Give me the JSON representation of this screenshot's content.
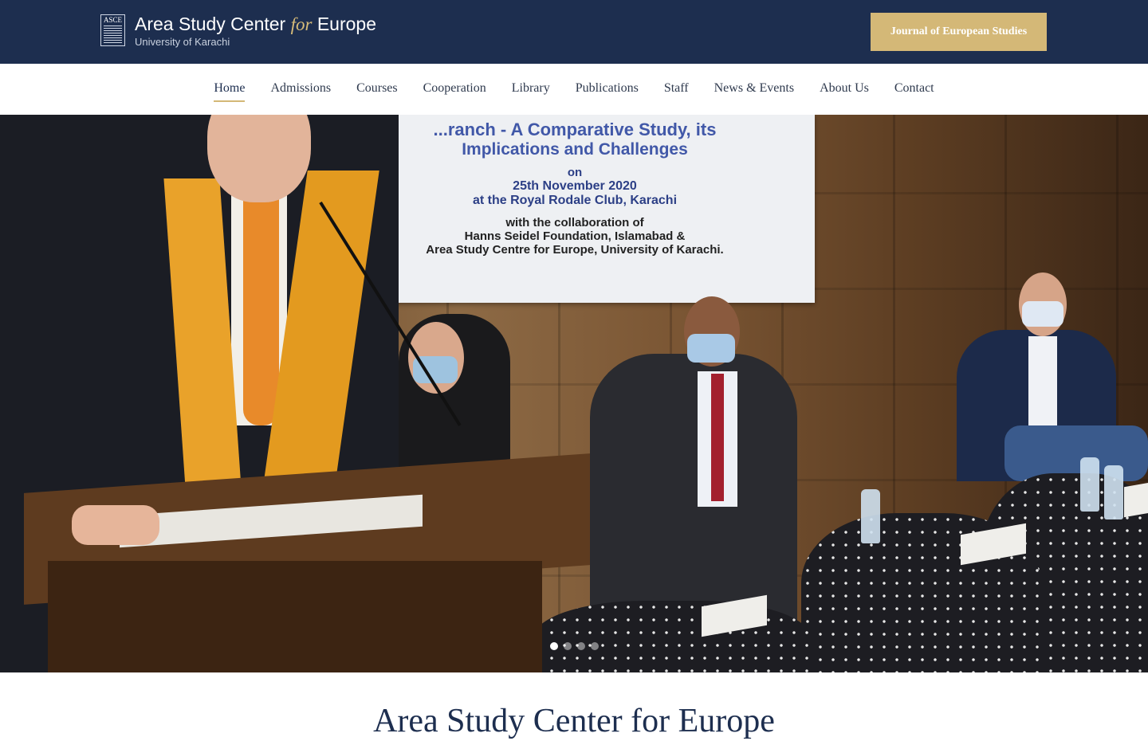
{
  "header": {
    "logo_abbr": "ASCE",
    "logo_title_main": "Area Study Center ",
    "logo_title_for": "for",
    "logo_title_end": " Europe",
    "logo_subtitle": "University of Karachi",
    "journal_button": "Journal of European Studies",
    "brand_color": "#1d2e4f",
    "accent_color": "#d4b877"
  },
  "nav": {
    "items": [
      {
        "label": "Home",
        "active": true
      },
      {
        "label": "Admissions"
      },
      {
        "label": "Courses"
      },
      {
        "label": "Cooperation"
      },
      {
        "label": "Library"
      },
      {
        "label": "Publications"
      },
      {
        "label": "Staff"
      },
      {
        "label": "News & Events"
      },
      {
        "label": "About Us"
      },
      {
        "label": "Contact"
      }
    ]
  },
  "hero": {
    "banner_lines": [
      "...ranch - A Comparative Study, its",
      "Implications and Challenges",
      "on",
      "25th November 2020",
      "at the Royal Rodale Club, Karachi",
      "with the collaboration of",
      "Hanns Seidel Foundation, Islamabad &",
      "Area Study Centre for Europe, University of Karachi."
    ],
    "slides_count": 4,
    "active_slide": 1
  },
  "section": {
    "title": "Area Study Center for Europe"
  }
}
